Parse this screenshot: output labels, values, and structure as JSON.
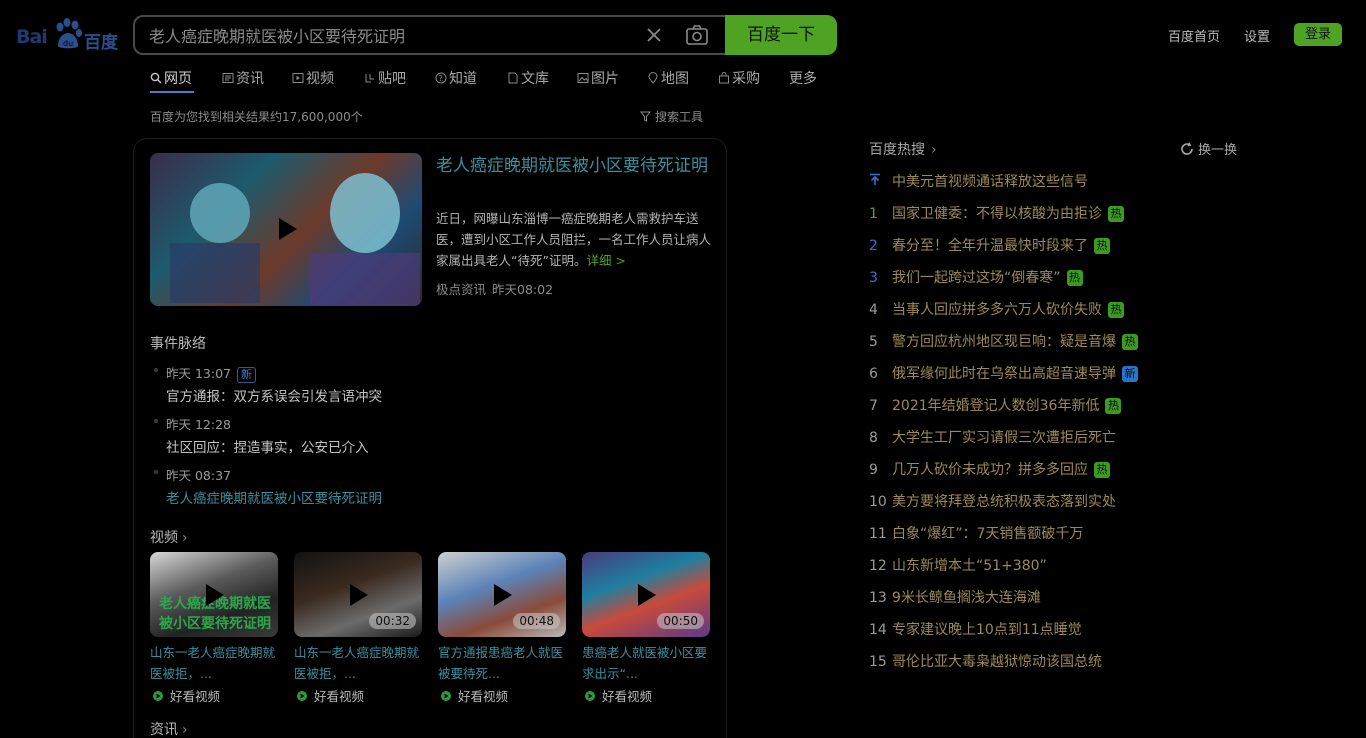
{
  "logo": {
    "text": "Bai",
    "cn": "百度"
  },
  "search": {
    "query": "老人癌症晚期就医被小区要待死证明",
    "button": "百度一下"
  },
  "top_links": {
    "home": "百度首页",
    "settings": "设置",
    "login": "登录"
  },
  "tabs": [
    {
      "label": "网页",
      "icon": "search-icon"
    },
    {
      "label": "资讯",
      "icon": "news-icon"
    },
    {
      "label": "视频",
      "icon": "video-icon"
    },
    {
      "label": "贴吧",
      "icon": "tieba-icon"
    },
    {
      "label": "知道",
      "icon": "question-icon"
    },
    {
      "label": "文库",
      "icon": "doc-icon"
    },
    {
      "label": "图片",
      "icon": "image-icon"
    },
    {
      "label": "地图",
      "icon": "map-icon"
    },
    {
      "label": "采购",
      "icon": "bag-icon"
    },
    {
      "label": "更多",
      "icon": ""
    }
  ],
  "results": {
    "count": "百度为您找到相关结果约17,600,000个",
    "tools": "搜索工具"
  },
  "main": {
    "title": "老人癌症晚期就医被小区要待死证明",
    "desc": "近日，网曝山东淄博一癌症晚期老人需救护车送医，遭到小区工作人员阻拦，一名工作人员让病人家属出具老人“待死”证明。",
    "more": "详细 >",
    "source": "极点资讯",
    "time": "昨天08:02"
  },
  "timeline": {
    "title": "事件脉络",
    "items": [
      {
        "time": "昨天 13:07",
        "tag": "新",
        "text": "官方通报：双方系误会引发言语冲突"
      },
      {
        "time": "昨天 12:28",
        "tag": "",
        "text": "社区回应：捏造事实，公安已介入"
      },
      {
        "time": "昨天 08:37",
        "tag": "",
        "text": "老人癌症晚期就医被小区要待死证明"
      }
    ]
  },
  "videos": {
    "title": "视频",
    "items": [
      {
        "caption": "山东一老人癌症晚期就医被拒，...",
        "duration": "",
        "source": "好看视频",
        "overlay": "老人癌症晚期就医 被小区要待死证明"
      },
      {
        "caption": "山东一老人癌症晚期就医被拒，...",
        "duration": "00:32",
        "source": "好看视频",
        "overlay": ""
      },
      {
        "caption": "官方通报患癌老人就医被要待死...",
        "duration": "00:48",
        "source": "好看视频",
        "overlay": ""
      },
      {
        "caption": "患癌老人就医被小区要求出示“...",
        "duration": "00:50",
        "source": "好看视频",
        "overlay": ""
      }
    ]
  },
  "news_title": "资讯",
  "hot": {
    "title": "百度热搜",
    "refresh": "换一换",
    "items": [
      {
        "num": "",
        "text": "中美元首视频通话释放这些信号",
        "badge": ""
      },
      {
        "num": "1",
        "text": "国家卫健委：不得以核酸为由拒诊",
        "badge": "热"
      },
      {
        "num": "2",
        "text": "春分至！全年升温最快时段来了",
        "badge": "热"
      },
      {
        "num": "3",
        "text": "我们一起跨过这场“倒春寒”",
        "badge": "热"
      },
      {
        "num": "4",
        "text": "当事人回应拼多多六万人砍价失败",
        "badge": "热"
      },
      {
        "num": "5",
        "text": "警方回应杭州地区现巨响：疑是音爆",
        "badge": "热"
      },
      {
        "num": "6",
        "text": "俄军缘何此时在乌祭出高超音速导弹",
        "badge": "新"
      },
      {
        "num": "7",
        "text": "2021年结婚登记人数创36年新低",
        "badge": "热"
      },
      {
        "num": "8",
        "text": "大学生工厂实习请假三次遭拒后死亡",
        "badge": ""
      },
      {
        "num": "9",
        "text": "几万人砍价未成功？拼多多回应",
        "badge": "热"
      },
      {
        "num": "10",
        "text": "美方要将拜登总统积极表态落到实处",
        "badge": ""
      },
      {
        "num": "11",
        "text": "白象“爆红”：7天销售额破千万",
        "badge": ""
      },
      {
        "num": "12",
        "text": "山东新增本土“51+380”",
        "badge": ""
      },
      {
        "num": "13",
        "text": "9米长鲸鱼搁浅大连海滩",
        "badge": ""
      },
      {
        "num": "14",
        "text": "专家建议晚上10点到11点睡觉",
        "badge": ""
      },
      {
        "num": "15",
        "text": "哥伦比亚大毒枭越狱惊动该国总统",
        "badge": ""
      }
    ]
  }
}
